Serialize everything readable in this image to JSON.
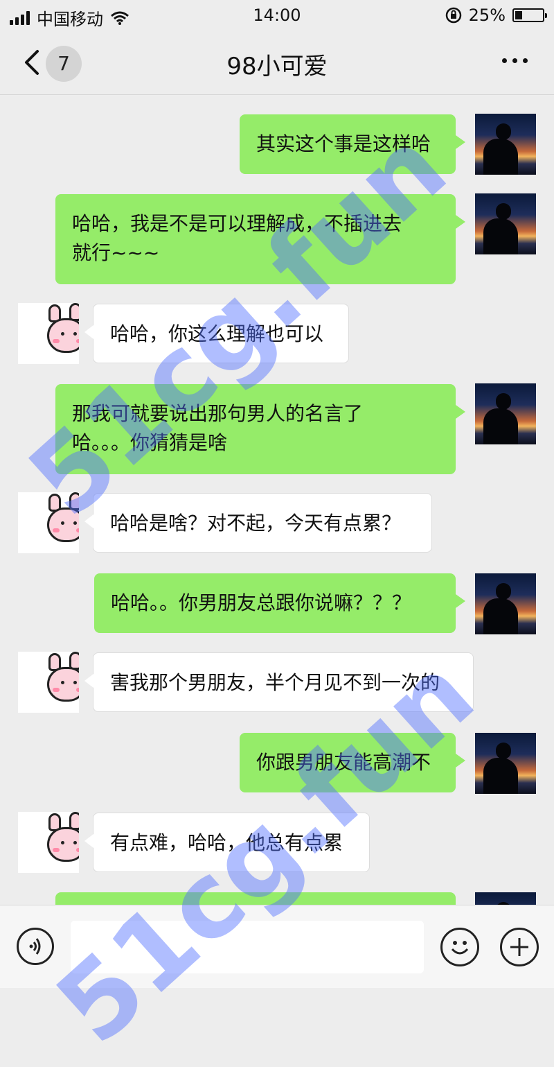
{
  "status_bar": {
    "carrier": "中国移动",
    "time": "14:00",
    "battery_percent": "25%",
    "battery_level": 0.25,
    "icons": [
      "signal-icon",
      "wifi-icon",
      "rotation-lock-icon",
      "battery-icon"
    ]
  },
  "nav": {
    "unread_count": "7",
    "title": "98小可爱",
    "icons": [
      "back-chevron-icon",
      "more-dots-icon"
    ]
  },
  "messages": [
    {
      "from": "me",
      "text": "其实这个事是这样哈"
    },
    {
      "from": "me",
      "text": "哈哈，我是不是可以理解成，不插进去\n就行~~~"
    },
    {
      "from": "them",
      "text": "哈哈，你这么理解也可以"
    },
    {
      "from": "me",
      "text": "那我可就要说出那句男人的名言了\n哈。。。你猜猜是啥"
    },
    {
      "from": "them",
      "text": "哈哈是啥？对不起，今天有点累？"
    },
    {
      "from": "me",
      "text": "哈哈。。你男朋友总跟你说嘛？？？"
    },
    {
      "from": "them",
      "text": "害我那个男朋友，半个月见不到一次的"
    },
    {
      "from": "me",
      "text": "你跟男朋友能高潮不"
    },
    {
      "from": "them",
      "text": "有点难，哈哈，他总有点累"
    },
    {
      "from": "me",
      "text": ""
    }
  ],
  "input_bar": {
    "placeholder": "",
    "icons": [
      "voice-icon",
      "emoji-icon",
      "plus-icon"
    ]
  },
  "watermark": {
    "text": "51cg.fun"
  },
  "colors": {
    "background": "#ededed",
    "sent_bubble": "#95ec69",
    "received_bubble": "#ffffff",
    "watermark": "#506eff"
  }
}
